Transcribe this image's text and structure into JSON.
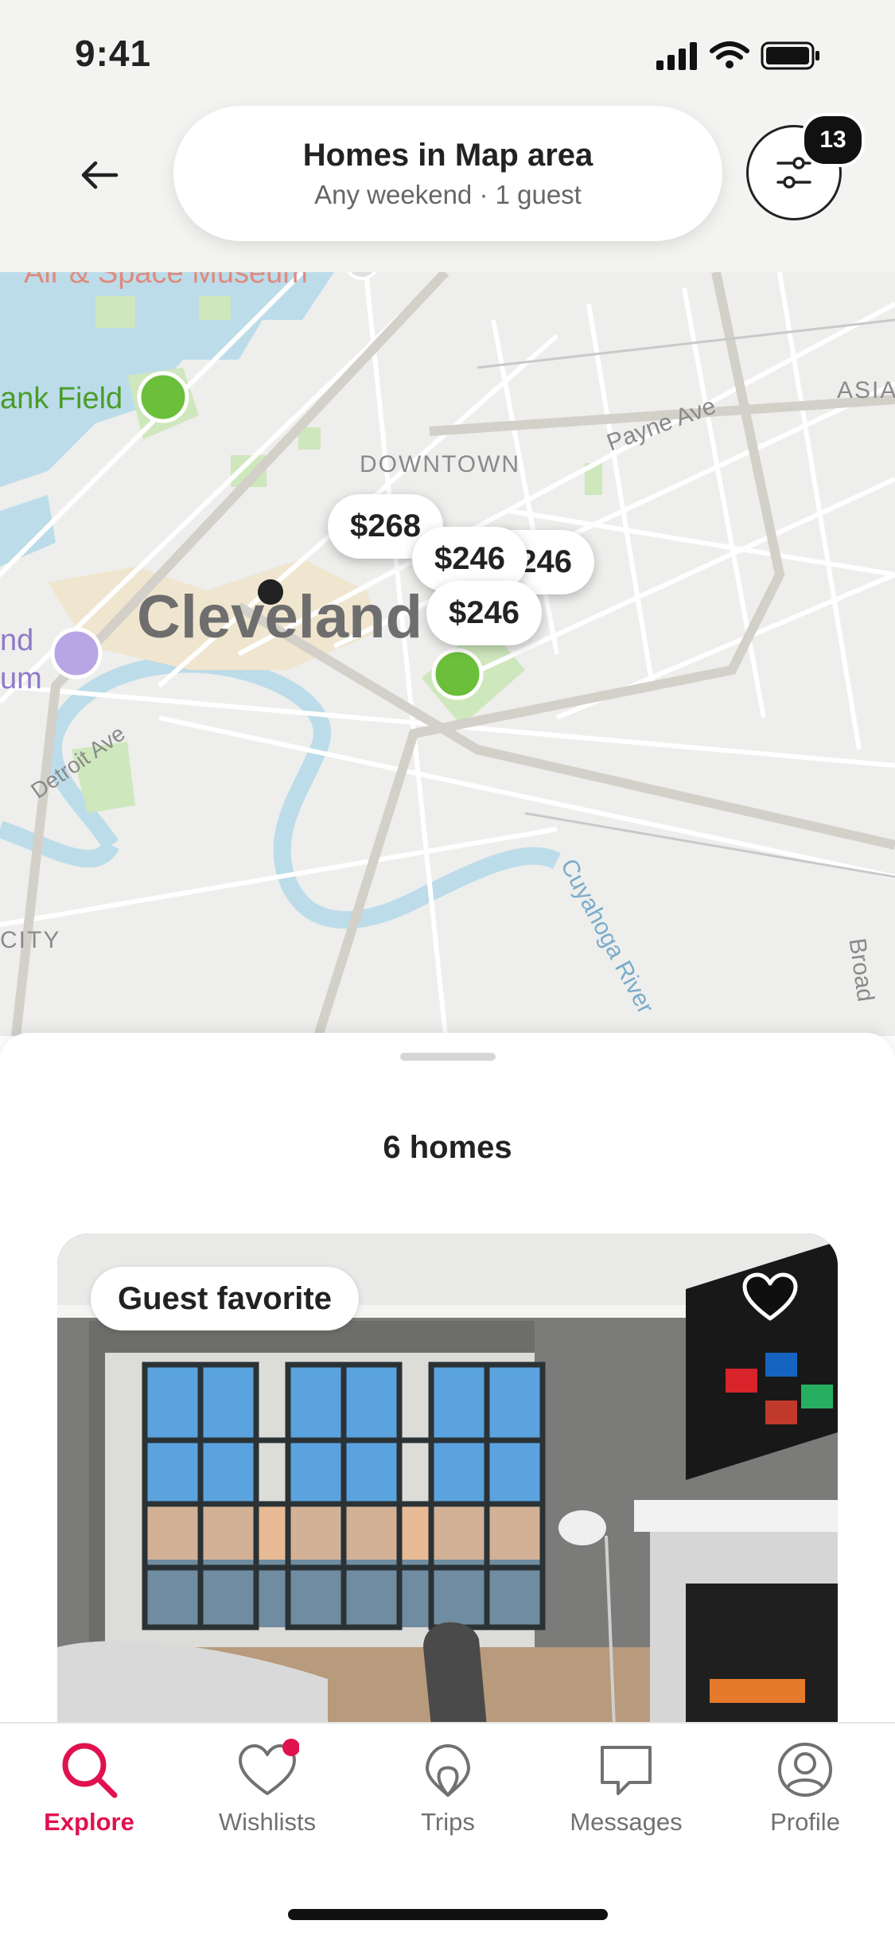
{
  "status_bar": {
    "time": "9:41"
  },
  "header": {
    "title": "Homes in Map area",
    "subtitle": "Any weekend · 1 guest",
    "filter_count": "13"
  },
  "map": {
    "labels": {
      "museum": "Air & Space Museum",
      "field": "ank Field",
      "downtown": "DOWNTOWN",
      "payne": "Payne Ave",
      "asia": "ASIA",
      "city_name": "Cleveland",
      "nd": "nd",
      "um": "um",
      "detroit": "Detroit Ave",
      "city_left": "CITY",
      "river": "Cuyahoga River",
      "broad": "Broad"
    },
    "price_pins": [
      "$268",
      "$246",
      "$246",
      "$246"
    ]
  },
  "sheet": {
    "homes_count": "6 homes",
    "listing": {
      "badge": "Guest favorite"
    }
  },
  "tabs": [
    {
      "label": "Explore",
      "icon": "search-icon",
      "active": true
    },
    {
      "label": "Wishlists",
      "icon": "heart-icon",
      "active": false
    },
    {
      "label": "Trips",
      "icon": "airbnb-icon",
      "active": false
    },
    {
      "label": "Messages",
      "icon": "message-icon",
      "active": false
    },
    {
      "label": "Profile",
      "icon": "profile-icon",
      "active": false
    }
  ],
  "colors": {
    "accent": "#E0114F",
    "map_water": "#AFD6EA",
    "map_park": "#C9E6B5"
  }
}
